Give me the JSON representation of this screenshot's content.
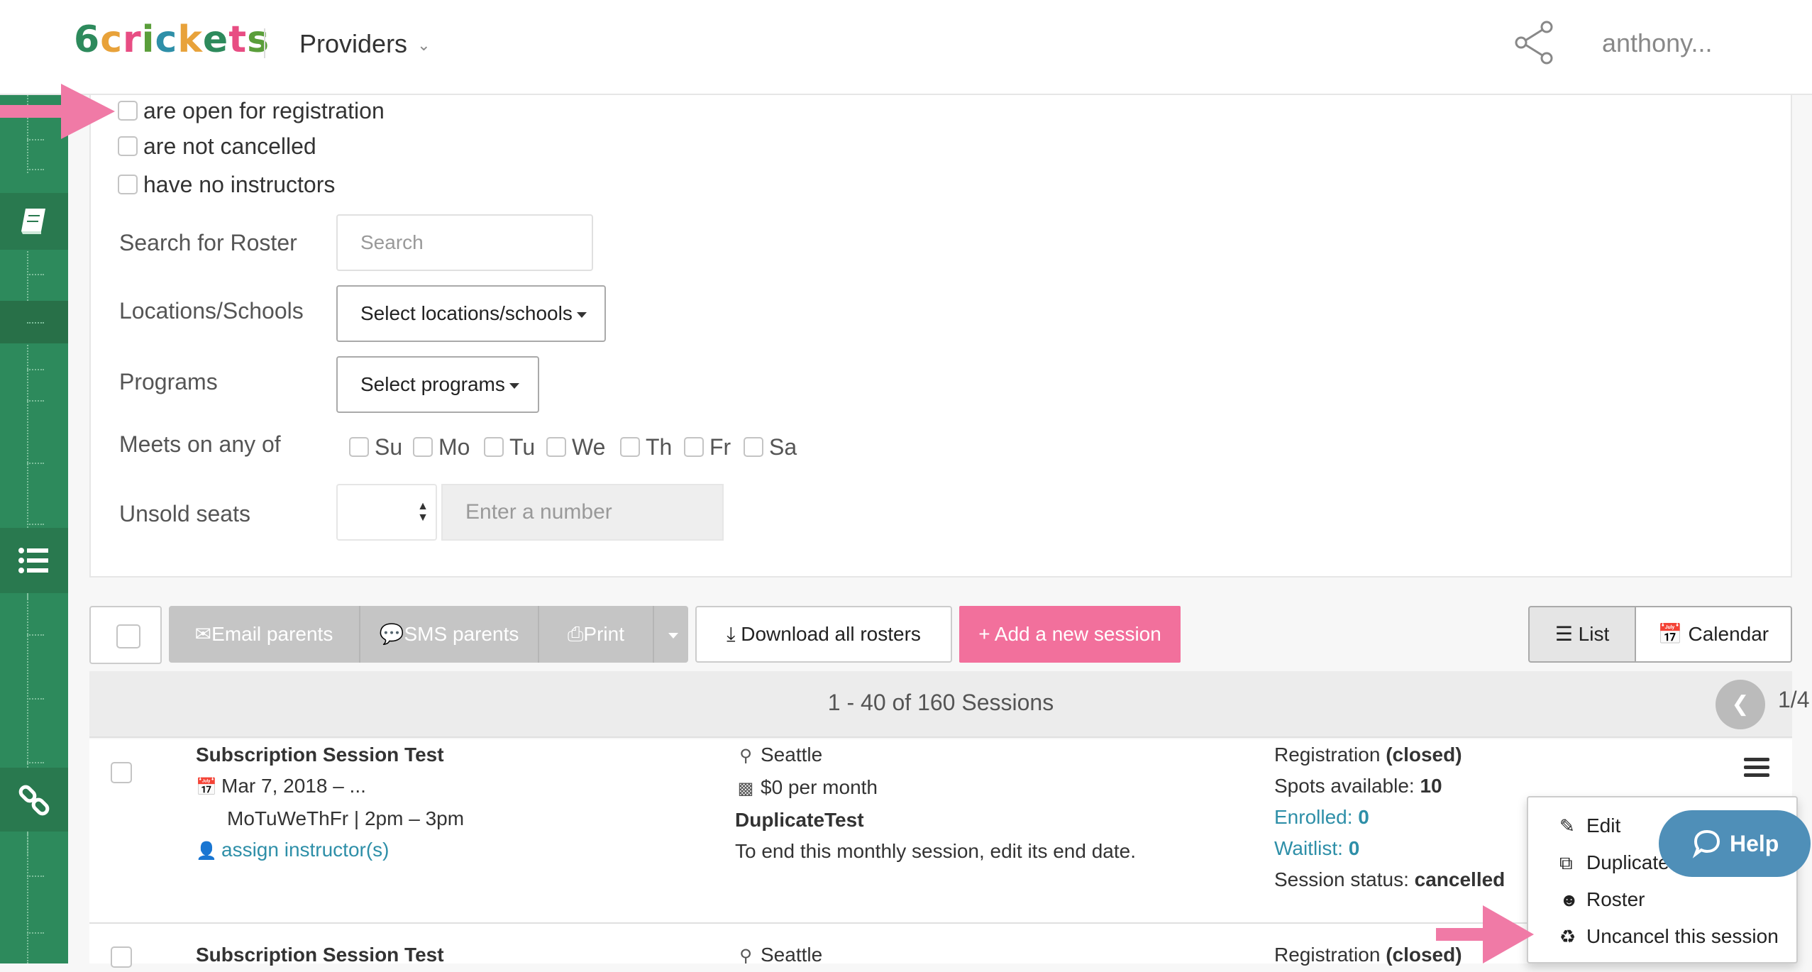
{
  "header": {
    "logo_chars": [
      "6",
      "c",
      "r",
      "i",
      "c",
      "k",
      "e",
      "t",
      "s"
    ],
    "logo_colors": [
      "#2d8a5c",
      "#e8a23a",
      "#e84d83",
      "#5a9e3a",
      "#2e8fa8",
      "#e8a23a",
      "#2d8a5c",
      "#e84d83",
      "#5a9e3a"
    ],
    "providers_label": "Providers",
    "user_name": "anthony..."
  },
  "filters": {
    "checkboxes": [
      "are open for registration",
      "are not cancelled",
      "have no instructors"
    ],
    "search_label": "Search for Roster",
    "search_placeholder": "Search",
    "locations_label": "Locations/Schools",
    "locations_button": "Select locations/schools",
    "programs_label": "Programs",
    "programs_button": "Select programs",
    "meets_label": "Meets on any of",
    "days": [
      "Su",
      "Mo",
      "Tu",
      "We",
      "Th",
      "Fr",
      "Sa"
    ],
    "unsold_label": "Unsold seats",
    "number_placeholder": "Enter a number"
  },
  "toolbar": {
    "email_parents": "Email parents",
    "sms_parents": "SMS parents",
    "print": "Print",
    "download_rosters": "Download all rosters",
    "add_session": "+ Add a new session",
    "list": "List",
    "calendar": "Calendar"
  },
  "pager": {
    "summary": "1 - 40 of 160 Sessions",
    "page": "1/4"
  },
  "sessions": [
    {
      "title": "Subscription Session Test",
      "date": "Mar 7, 2018 – ...",
      "schedule": "MoTuWeThFr | 2pm – 3pm",
      "instructor_link": "assign instructor(s)",
      "location": "Seattle",
      "price": "$0 per month",
      "program": "DuplicateTest",
      "note": "To end this monthly session, edit its end date.",
      "registration_label": "Registration",
      "registration_status": "(closed)",
      "spots_label": "Spots available:",
      "spots": "10",
      "enrolled_label": "Enrolled:",
      "enrolled": "0",
      "waitlist_label": "Waitlist:",
      "waitlist": "0",
      "status_label": "Session status:",
      "status": "cancelled"
    },
    {
      "title": "Subscription Session Test",
      "location": "Seattle",
      "registration_label": "Registration",
      "registration_status": "(closed)"
    }
  ],
  "menu": {
    "items": [
      "Edit",
      "Duplicate",
      "Roster",
      "Uncancel this session"
    ]
  },
  "help": {
    "label": "Help"
  },
  "colors": {
    "brand_green": "#2d8a5c",
    "accent_pink": "#f2709c",
    "link_blue": "#2e8fa8",
    "help_blue": "#4f8fb8",
    "arrow_pink": "#f07aa6"
  }
}
